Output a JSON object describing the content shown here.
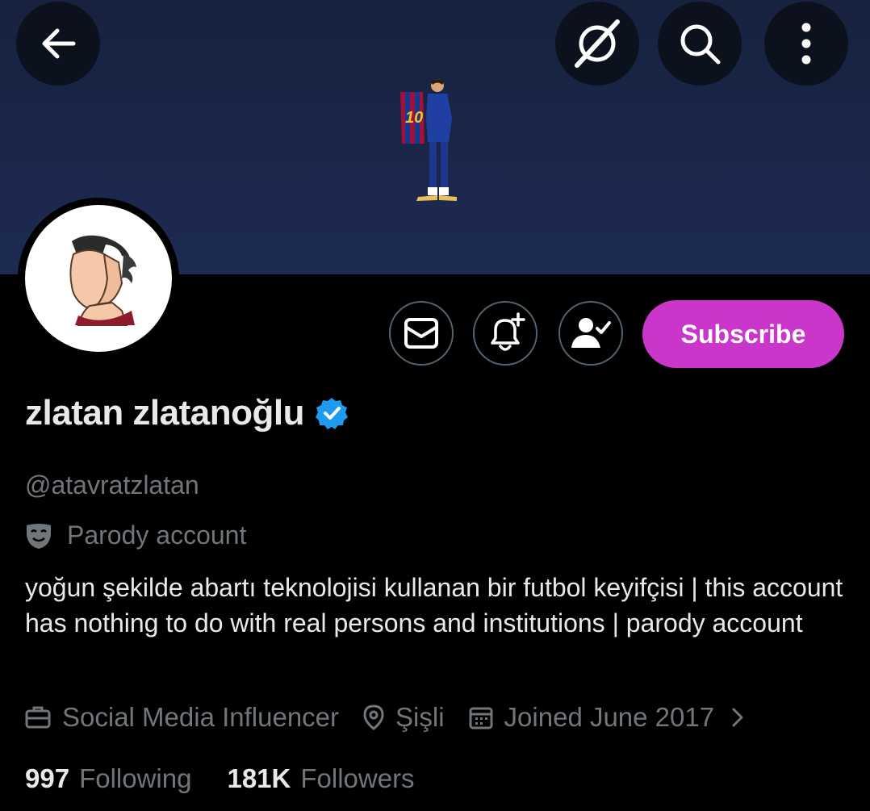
{
  "header": {
    "back_icon": "arrow-left-icon",
    "grok_icon": "grok-icon",
    "search_icon": "search-icon",
    "more_icon": "more-vertical-icon"
  },
  "banner": {
    "background_color": "#1d2a52",
    "jersey_number": "10"
  },
  "actions": {
    "message_icon": "envelope-icon",
    "notify_icon": "bell-plus-icon",
    "following_icon": "user-check-icon",
    "subscribe_label": "Subscribe",
    "subscribe_color": "#c936c9"
  },
  "profile": {
    "name": "zlatan zlatanoğlu",
    "verified": true,
    "handle": "@atavratzlatan",
    "parody_label": "Parody account",
    "bio": "yoğun şekilde abartı teknolojisi kullanan bir futbol keyifçisi | this account has nothing to do with real persons and institutions | parody account",
    "category": "Social Media Influencer",
    "location": "Şişli",
    "joined": "Joined June 2017"
  },
  "stats": {
    "following_count": "997",
    "following_label": "Following",
    "followers_count": "181K",
    "followers_label": "Followers"
  },
  "colors": {
    "muted": "#71767b",
    "text": "#e7e9ea",
    "verified": "#1d9bf0"
  }
}
